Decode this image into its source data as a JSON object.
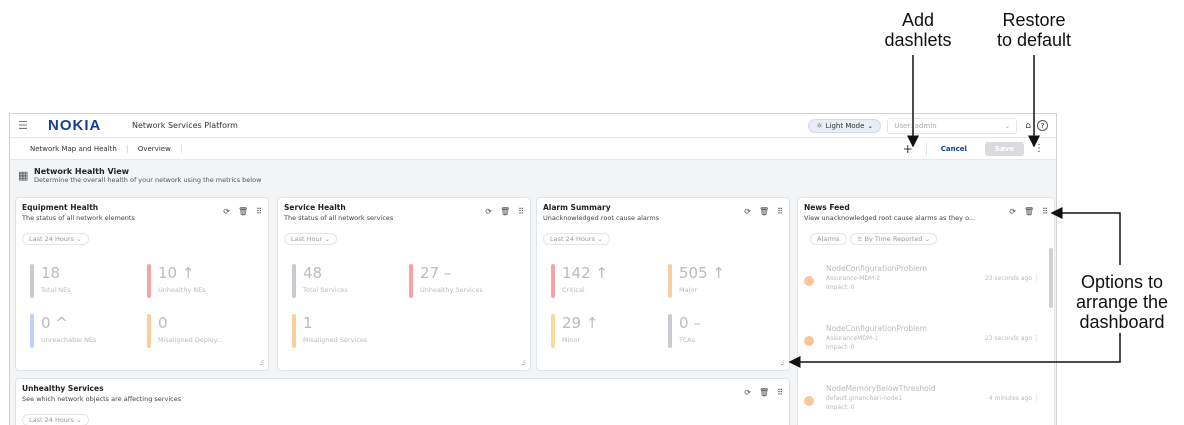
{
  "annotations": {
    "add_dashlets": "Add\ndashlets",
    "restore_default": "Restore\nto default",
    "arrange": "Options to\narrange the\ndashboard"
  },
  "topbar": {
    "logo": "NOKIA",
    "app_title": "Network Services Platform",
    "mode_label": "Light Mode",
    "user_label": "User: admin"
  },
  "tabs": [
    "Network Map and Health",
    "Overview"
  ],
  "actions": {
    "add": "+",
    "cancel": "Cancel",
    "save": "Save"
  },
  "view": {
    "title": "Network Health View",
    "description": "Determine the overall health of your network using the metrics below"
  },
  "dashlets": {
    "equipment": {
      "title": "Equipment Health",
      "subtitle": "The status of all network elements",
      "filter": "Last 24 Hours",
      "metrics": [
        {
          "value": "18",
          "label": "Total NEs",
          "color": "#c8cbd0"
        },
        {
          "value": "10 ↑",
          "label": "Unhealthy NEs",
          "color": "#f5a3a3"
        },
        {
          "value": "0 ^",
          "label": "Unreachable NEs",
          "color": "#bcd2f0"
        },
        {
          "value": "0",
          "label": "Misaligned Deploy...",
          "color": "#f8cf9e"
        }
      ]
    },
    "service": {
      "title": "Service Health",
      "subtitle": "The status of all network services",
      "filter": "Last Hour",
      "metrics": [
        {
          "value": "48",
          "label": "Total Services",
          "color": "#c8cbd0"
        },
        {
          "value": "27 –",
          "label": "Unhealthy Services",
          "color": "#f5a3a3"
        },
        {
          "value": "1",
          "label": "Misaligned Services",
          "color": "#f8cf9e"
        }
      ]
    },
    "alarm": {
      "title": "Alarm Summary",
      "subtitle": "Unacknowledged root cause alarms",
      "filter": "Last 24 Hours",
      "metrics": [
        {
          "value": "142 ↑",
          "label": "Critical",
          "color": "#f5a3a3"
        },
        {
          "value": "505 ↑",
          "label": "Major",
          "color": "#f8cf9e"
        },
        {
          "value": "29 ↑",
          "label": "Minor",
          "color": "#f9dc9c"
        },
        {
          "value": "0 –",
          "label": "TCAs",
          "color": "#c8cbd0"
        }
      ]
    },
    "news": {
      "title": "News Feed",
      "subtitle": "View unacknowledged root cause alarms as they o...",
      "filter_1": "Alarms",
      "filter_2": "By Time Reported",
      "items": [
        {
          "name": "NodeConfigurationProblem",
          "source": "Assurance-MDM-2",
          "impact": "Impact: 0",
          "time": "23 seconds ago"
        },
        {
          "name": "NodeConfigurationProblem",
          "source": "AssuranceMDM-1",
          "impact": "Impact: 0",
          "time": "23 seconds ago"
        },
        {
          "name": "NodeMemoryBelowThreshold",
          "source": "default.gmanchari-node1",
          "impact": "Impact: 0",
          "time": "4 minutes ago"
        }
      ]
    },
    "unhealthy": {
      "title": "Unhealthy Services",
      "subtitle": "See which network objects are affecting services",
      "filter": "Last 24 Hours"
    }
  }
}
